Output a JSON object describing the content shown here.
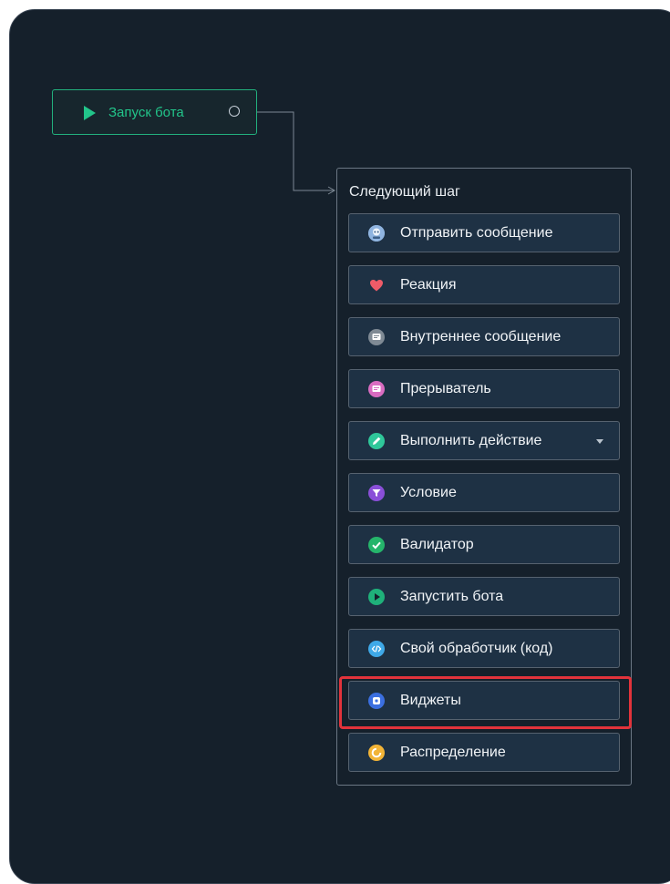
{
  "start_node": {
    "label": "Запуск бота",
    "icon": "play-icon",
    "accent": "#22c58a"
  },
  "panel": {
    "title": "Следующий шаг",
    "steps": [
      {
        "label": "Отправить сообщение",
        "icon": "robot-message-icon",
        "color": "#7aa6d8"
      },
      {
        "label": "Реакция",
        "icon": "heart-icon",
        "color": "#ef5b68"
      },
      {
        "label": "Внутреннее сообщение",
        "icon": "internal-message-icon",
        "color": "#7f8a94"
      },
      {
        "label": "Прерыватель",
        "icon": "interrupt-message-icon",
        "color": "#d96cc1"
      },
      {
        "label": "Выполнить действие",
        "icon": "pencil-icon",
        "color": "#2fc79a"
      },
      {
        "label": "Условие",
        "icon": "filter-icon",
        "color": "#8a4fd8"
      },
      {
        "label": "Валидатор",
        "icon": "check-icon",
        "color": "#25b56b"
      },
      {
        "label": "Запустить бота",
        "icon": "play-circle-icon",
        "color": "#1fb17a"
      },
      {
        "label": "Свой обработчик (код)",
        "icon": "code-icon",
        "color": "#3fa9e8"
      },
      {
        "label": "Виджеты",
        "icon": "widget-icon",
        "color": "#3b6fe0"
      },
      {
        "label": "Распределение",
        "icon": "distribution-icon",
        "color": "#f2b437"
      }
    ]
  },
  "highlight_color": "#e2333b"
}
